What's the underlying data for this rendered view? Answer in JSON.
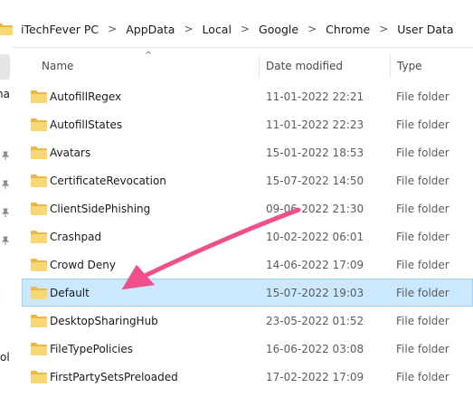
{
  "breadcrumb": [
    "iTechFever PC",
    "AppData",
    "Local",
    "Google",
    "Chrome",
    "User Data"
  ],
  "breadcrumb_separator": ">",
  "nav_pane": {
    "label_fragments": [
      "na",
      "ol"
    ]
  },
  "columns": {
    "name": "Name",
    "date_modified": "Date modified",
    "type": "Type"
  },
  "files": [
    {
      "name": "AutofillRegex",
      "date": "11-01-2022 22:21",
      "type": "File folder"
    },
    {
      "name": "AutofillStates",
      "date": "11-01-2022 22:23",
      "type": "File folder"
    },
    {
      "name": "Avatars",
      "date": "15-01-2022 18:53",
      "type": "File folder"
    },
    {
      "name": "CertificateRevocation",
      "date": "15-07-2022 14:50",
      "type": "File folder"
    },
    {
      "name": "ClientSidePhishing",
      "date": "09-06-2022 21:30",
      "type": "File folder"
    },
    {
      "name": "Crashpad",
      "date": "10-02-2022 06:01",
      "type": "File folder"
    },
    {
      "name": "Crowd Deny",
      "date": "14-06-2022 17:09",
      "type": "File folder"
    },
    {
      "name": "Default",
      "date": "15-07-2022 19:03",
      "type": "File folder",
      "selected": true
    },
    {
      "name": "DesktopSharingHub",
      "date": "23-05-2022 01:52",
      "type": "File folder"
    },
    {
      "name": "FileTypePolicies",
      "date": "16-06-2022 03:08",
      "type": "File folder"
    },
    {
      "name": "FirstPartySetsPreloaded",
      "date": "17-02-2022 17:09",
      "type": "File folder"
    }
  ],
  "colors": {
    "folder": "#f8d775",
    "folder_dark": "#e8b84a",
    "selection": "#cce8ff",
    "annotation_arrow": "#f0508a"
  }
}
